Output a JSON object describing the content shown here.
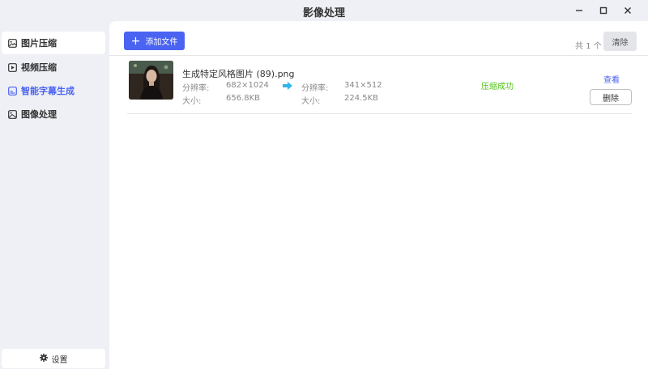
{
  "window": {
    "title": "影像处理"
  },
  "sidebar": {
    "items": [
      {
        "label": "图片压缩",
        "icon": "image-compress-icon"
      },
      {
        "label": "视频压缩",
        "icon": "video-compress-icon"
      },
      {
        "label": "智能字幕生成",
        "icon": "subtitle-icon"
      },
      {
        "label": "图像处理",
        "icon": "image-process-icon"
      }
    ],
    "settings_label": "设置"
  },
  "toolbar": {
    "add_label": "添加文件",
    "count_text": "共 1 个",
    "clear_label": "清除"
  },
  "file": {
    "name": "生成特定风格图片 (89).png",
    "resolution_label": "分辨率:",
    "size_label": "大小:",
    "original_resolution": "682×1024",
    "original_size": "656.8KB",
    "new_resolution": "341×512",
    "new_size": "224.5KB",
    "status": "压缩成功",
    "view_label": "查看",
    "delete_label": "删除"
  },
  "colors": {
    "accent": "#4a63f1",
    "success": "#52c41a",
    "arrow": "#33b5ea",
    "background": "#eef0f5"
  }
}
